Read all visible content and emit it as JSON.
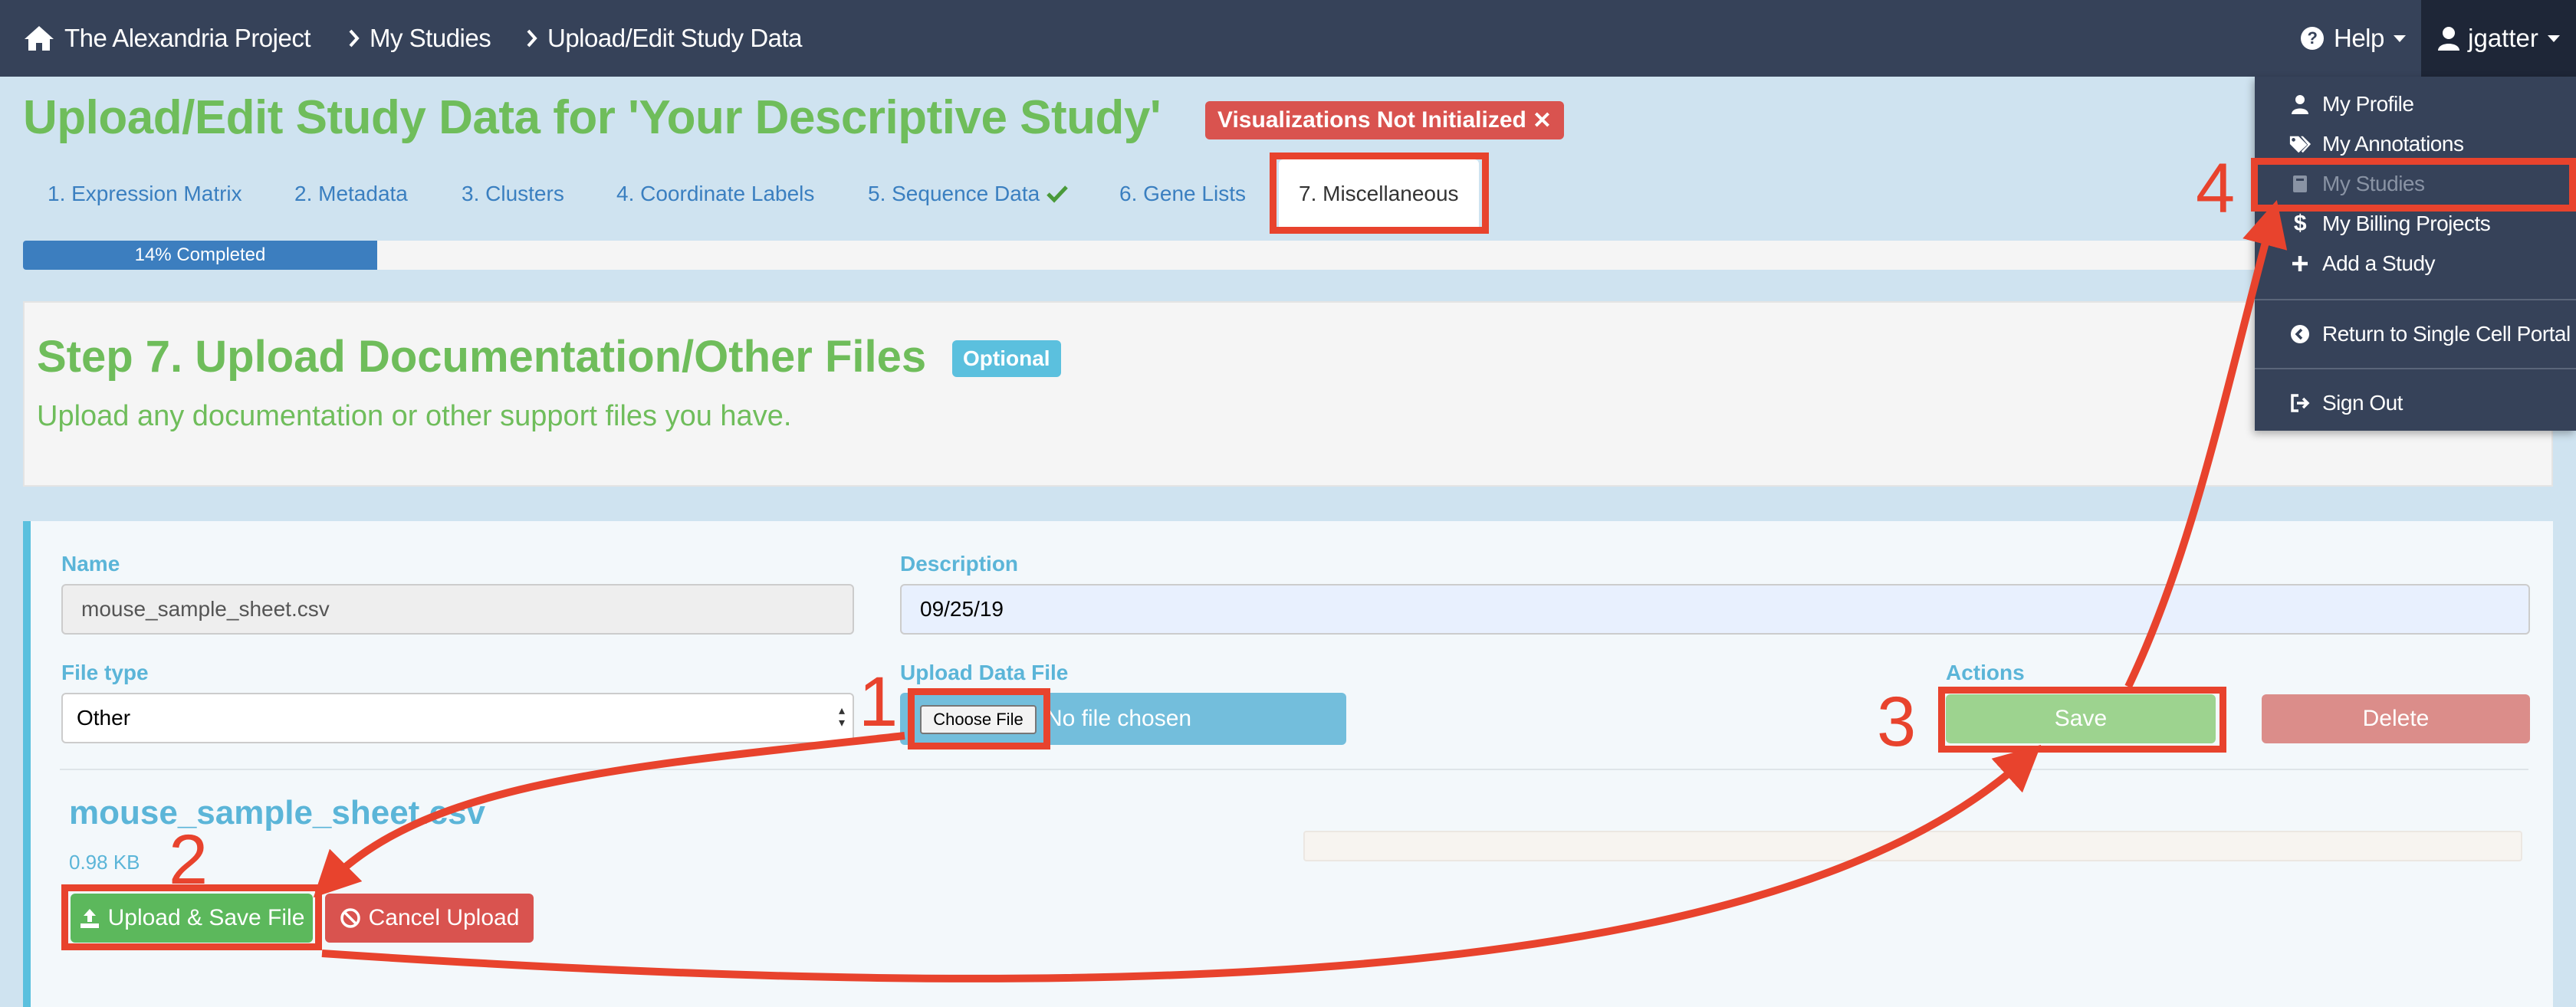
{
  "navbar": {
    "brand": "The Alexandria Project",
    "crumbs": [
      "My Studies",
      "Upload/Edit Study Data"
    ],
    "help": "Help",
    "user": "jgatter"
  },
  "page": {
    "title": "Upload/Edit Study Data for 'Your Descriptive Study'",
    "badge": "Visualizations Not Initialized"
  },
  "tabs": [
    {
      "label": "1. Expression Matrix"
    },
    {
      "label": "2. Metadata"
    },
    {
      "label": "3. Clusters"
    },
    {
      "label": "4. Coordinate Labels"
    },
    {
      "label": "5. Sequence Data",
      "checked": true
    },
    {
      "label": "6. Gene Lists"
    },
    {
      "label": "7. Miscellaneous",
      "active": true
    }
  ],
  "progress": {
    "label": "14% Completed",
    "percent": 14
  },
  "step": {
    "title": "Step 7. Upload Documentation/Other Files",
    "badge": "Optional",
    "subtitle": "Upload any documentation or other support files you have."
  },
  "form": {
    "name_label": "Name",
    "name_value": "mouse_sample_sheet.csv",
    "description_label": "Description",
    "description_value": "09/25/19",
    "filetype_label": "File type",
    "filetype_value": "Other",
    "upload_label": "Upload Data File",
    "choose_file": "Choose File",
    "no_file": "No file chosen",
    "actions_label": "Actions",
    "save": "Save",
    "delete": "Delete",
    "file_name": "mouse_sample_sheet.csv",
    "file_size": "0.98 KB",
    "upload_save": "Upload & Save File",
    "cancel_upload": "Cancel Upload"
  },
  "dropdown": {
    "items": [
      "My Profile",
      "My Annotations",
      "My Studies",
      "My Billing Projects",
      "Add a Study"
    ],
    "return": "Return to Single Cell Portal",
    "signout": "Sign Out"
  },
  "annotations": [
    "1",
    "2",
    "3",
    "4"
  ],
  "colors": {
    "navbar": "#364259",
    "green_title": "#6fbd5b",
    "link": "#3a7fc0",
    "info": "#5bc0de",
    "danger": "#d9534f",
    "success": "#5cb85c",
    "annotation": "#e8432d"
  }
}
